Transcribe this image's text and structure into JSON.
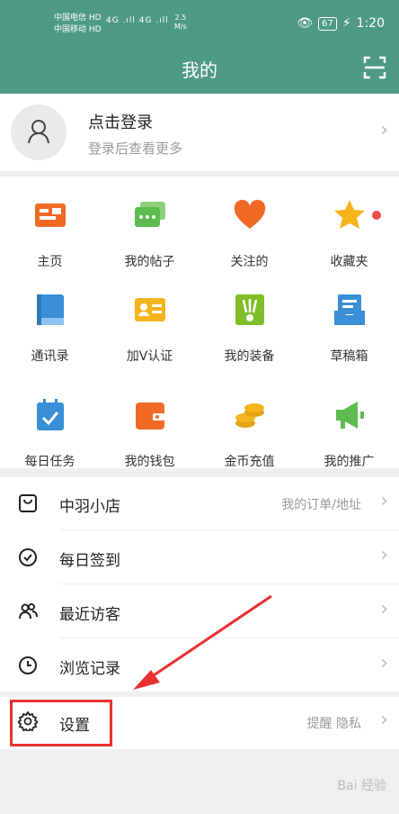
{
  "status_bar": {
    "carrier1": "中国电信 HD",
    "carrier2": "中国移动 HD",
    "signal": "4G .ıll 4G .ıll",
    "speed_value": "2.5",
    "speed_unit": "M/s",
    "battery": "67",
    "time": "1:20"
  },
  "header": {
    "title": "我的"
  },
  "profile": {
    "title": "点击登录",
    "subtitle": "登录后查看更多"
  },
  "grid": [
    {
      "label": "主页",
      "icon": "home-card-icon",
      "color": "#f06a25"
    },
    {
      "label": "我的帖子",
      "icon": "posts-chat-icon",
      "color": "#5dbb50"
    },
    {
      "label": "关注的",
      "icon": "heart-icon",
      "color": "#f06a25"
    },
    {
      "label": "收藏夹",
      "icon": "star-icon",
      "color": "#f6b51b"
    },
    {
      "label": "通讯录",
      "icon": "contacts-book-icon",
      "color": "#3a8fd6"
    },
    {
      "label": "加V认证",
      "icon": "verify-id-icon",
      "color": "#f5b51c"
    },
    {
      "label": "我的装备",
      "icon": "shuttlecock-icon",
      "color": "#7fbd28"
    },
    {
      "label": "草稿箱",
      "icon": "drafts-tray-icon",
      "color": "#3a8fd6"
    },
    {
      "label": "每日任务",
      "icon": "daily-task-icon",
      "color": "#3a8fd6"
    },
    {
      "label": "我的钱包",
      "icon": "wallet-icon",
      "color": "#f06a25"
    },
    {
      "label": "金币充值",
      "icon": "coins-icon",
      "color": "#f5b51c"
    },
    {
      "label": "我的推广",
      "icon": "megaphone-icon",
      "color": "#5dbb50"
    }
  ],
  "list": [
    {
      "label": "中羽小店",
      "right": "我的订单/地址",
      "icon": "shop-bag-icon"
    },
    {
      "label": "每日签到",
      "right": "",
      "icon": "check-circle-icon"
    },
    {
      "label": "最近访客",
      "right": "",
      "icon": "visitors-icon"
    },
    {
      "label": "浏览记录",
      "right": "",
      "icon": "clock-icon"
    }
  ],
  "settings": {
    "label": "设置",
    "right": "提醒 隐私",
    "icon": "gear-icon"
  },
  "watermark": "Bai 经验",
  "colors": {
    "brand": "#4f9a86",
    "highlight": "#e8312f",
    "badge": "#f24a4a"
  }
}
